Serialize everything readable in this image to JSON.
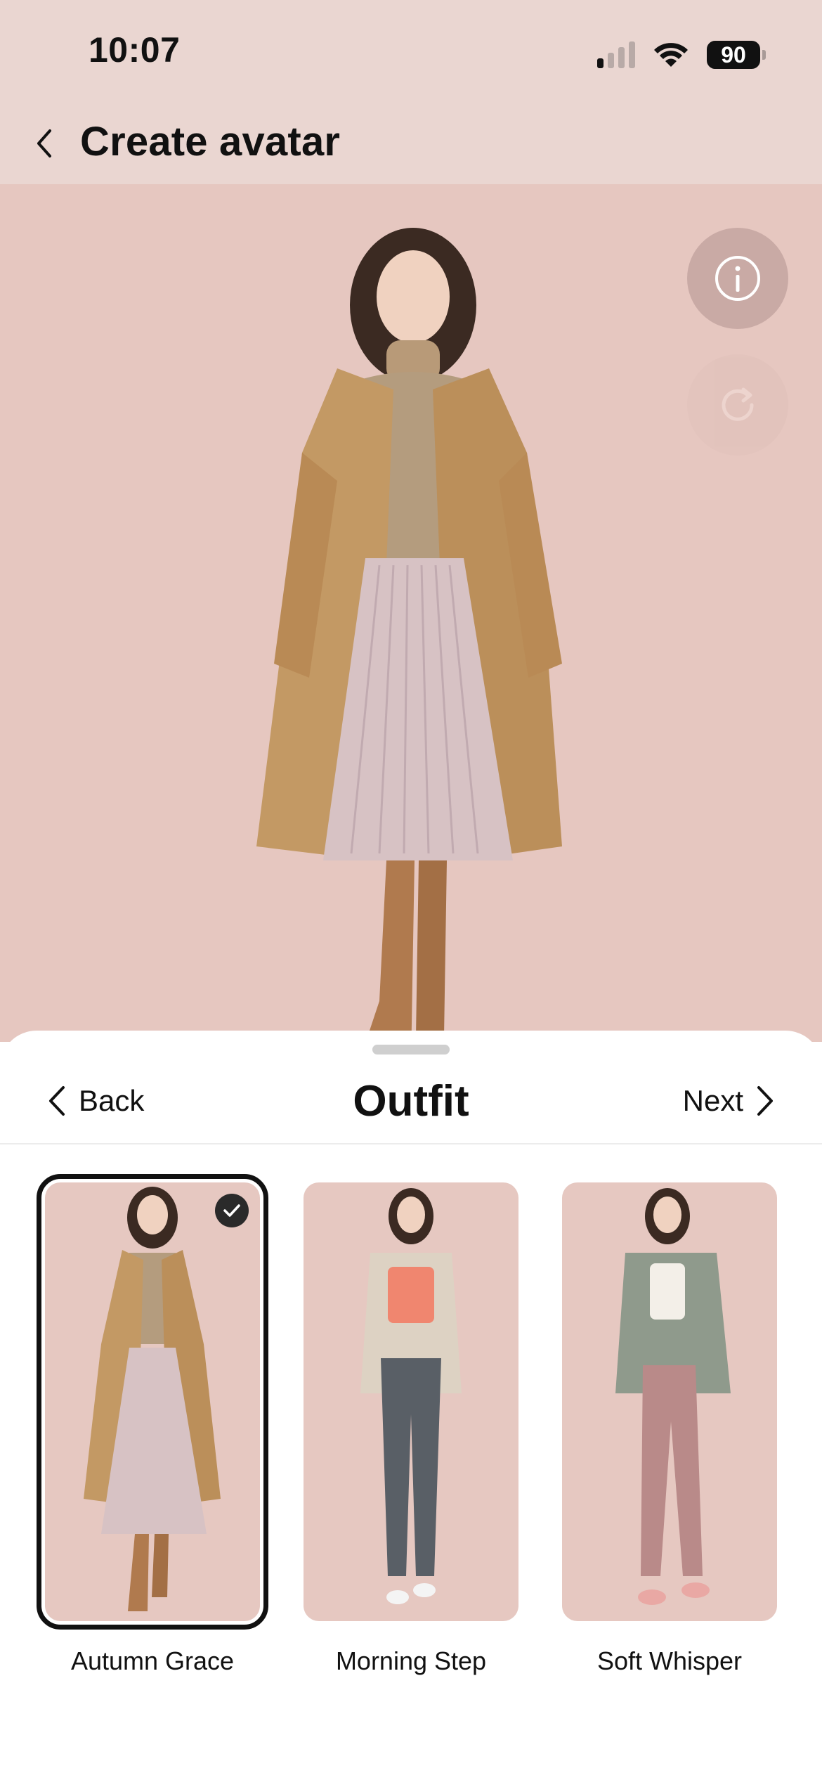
{
  "status_bar": {
    "time": "10:07",
    "battery": "90",
    "signal_bars_active": 1,
    "signal_bars_total": 4
  },
  "header": {
    "title": "Create avatar",
    "back_icon": "chevron-left-icon"
  },
  "preview": {
    "avatar_outfit": "Autumn Grace",
    "info_icon": "info-icon",
    "refresh_icon": "refresh-icon"
  },
  "sheet": {
    "title": "Outfit",
    "back_label": "Back",
    "next_label": "Next",
    "outfits": [
      {
        "label": "Autumn Grace",
        "selected": true
      },
      {
        "label": "Morning Step",
        "selected": false
      },
      {
        "label": "Soft Whisper",
        "selected": false
      }
    ]
  },
  "colors": {
    "header_bg": "#ead6d1",
    "preview_bg": "#e6c7c0",
    "card_bg": "#e6c8c1",
    "text": "#111111"
  }
}
